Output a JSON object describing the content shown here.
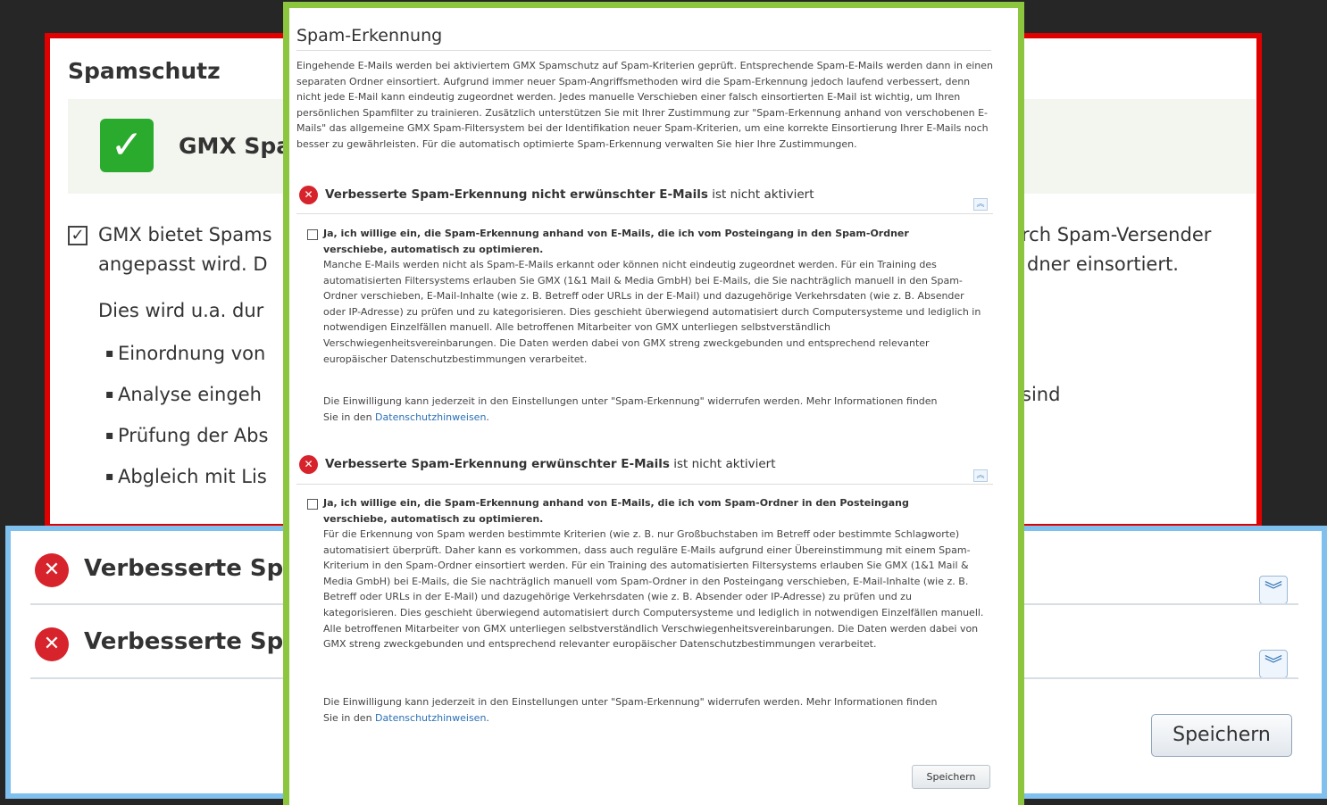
{
  "background": {
    "spamschutz": {
      "title": "Spamschutz",
      "status_text": "GMX Spa",
      "desc_line1_left": "GMX bietet Spams",
      "desc_line1_right": "rch Spam-Versender",
      "desc_line2_left": "angepasst wird. D",
      "desc_line2_right": "dner einsortiert.",
      "intro_line": "Dies wird u.a. dur",
      "bullets": [
        "Einordnung von",
        "Analyse eingeh",
        "Prüfung der Abs",
        "Abgleich mit Lis"
      ],
      "bullet2_right": "sind"
    },
    "rows": [
      {
        "title": "Verbesserte Spa",
        "expand_icon": "double-chevron-down"
      },
      {
        "title": "Verbesserte Spa",
        "expand_icon": "double-chevron-down"
      }
    ],
    "save_label": "Speichern"
  },
  "modal": {
    "title": "Spam-Erkennung",
    "intro": "Eingehende E-Mails werden bei aktiviertem GMX Spamschutz auf Spam-Kriterien geprüft. Entsprechende Spam-E-Mails werden dann in einen separaten Ordner einsortiert. Aufgrund immer neuer Spam-Angriffsmethoden wird die Spam-Erkennung jedoch laufend verbessert, denn nicht jede E-Mail kann eindeutig zugeordnet werden. Jedes manuelle Verschieben einer falsch einsortierten E-Mail ist wichtig, um Ihren persönlichen Spamfilter zu trainieren. Zusätzlich unterstützen Sie mit Ihrer Zustimmung zur \"Spam-Erkennung anhand von verschobenen E-Mails\" das allgemeine GMX Spam-Filtersystem bei der Identifikation neuer Spam-Kriterien, um eine korrekte Einsortierung Ihrer E-Mails noch besser zu gewährleisten. Für die automatisch optimierte Spam-Erkennung verwalten Sie hier Ihre Zustimmungen.",
    "sections": [
      {
        "title_bold": "Verbesserte Spam-Erkennung nicht erwünschter E-Mails",
        "title_status": " ist nicht aktiviert",
        "checkbox_label": "Ja, ich willige ein, die Spam-Erkennung anhand von E-Mails, die ich vom Posteingang in den Spam-Ordner verschiebe, automatisch zu optimieren.",
        "description": "Manche E-Mails werden nicht als Spam-E-Mails erkannt oder können nicht eindeutig zugeordnet werden. Für ein Training des automatisierten Filtersystems erlauben Sie GMX (1&1 Mail & Media GmbH) bei E-Mails, die Sie nachträglich manuell in den Spam-Ordner verschieben, E-Mail-Inhalte (wie z. B. Betreff oder URLs in der E-Mail) und dazugehörige Verkehrsdaten (wie z. B. Absender oder IP-Adresse) zu prüfen und zu kategorisieren. Dies geschieht überwiegend automatisiert durch Computersysteme und lediglich in notwendigen Einzelfällen manuell. Alle betroffenen Mitarbeiter von GMX unterliegen selbstverständlich Verschwiegenheitsvereinbarungen. Die Daten werden dabei von GMX streng zweckgebunden und entsprechend relevanter europäischer Datenschutzbestimmungen verarbeitet.",
        "note": "Die Einwilligung kann jederzeit in den Einstellungen unter \"Spam-Erkennung\" widerrufen werden. Mehr Informationen finden Sie in den ",
        "link": "Datenschutzhinweisen",
        "note_end": "."
      },
      {
        "title_bold": "Verbesserte Spam-Erkennung erwünschter E-Mails",
        "title_status": " ist nicht aktiviert",
        "checkbox_label": "Ja, ich willige ein, die Spam-Erkennung anhand von E-Mails, die ich vom Spam-Ordner in den Posteingang verschiebe, automatisch zu optimieren.",
        "description": "Für die Erkennung von Spam werden bestimmte Kriterien (wie z. B. nur Großbuchstaben im Betreff oder bestimmte Schlagworte) automatisiert überprüft. Daher kann es vorkommen, dass auch reguläre E-Mails aufgrund einer Übereinstimmung mit einem Spam-Kriterium in den Spam-Ordner einsortiert werden. Für ein Training des automatisierten Filtersystems erlauben Sie GMX (1&1 Mail & Media GmbH) bei E-Mails, die Sie nachträglich manuell vom Spam-Ordner in den Posteingang verschieben, E-Mail-Inhalte (wie z. B. Betreff oder URLs in der E-Mail) und dazugehörige Verkehrsdaten (wie z. B. Absender oder IP-Adresse) zu prüfen und zu kategorisieren. Dies geschieht überwiegend automatisiert durch Computersysteme und lediglich in notwendigen Einzelfällen manuell. Alle betroffenen Mitarbeiter von GMX unterliegen selbstverständlich Verschwiegenheitsvereinbarungen. Die Daten werden dabei von GMX streng zweckgebunden und entsprechend relevanter europäischer Datenschutzbestimmungen verarbeitet.",
        "note": "Die Einwilligung kann jederzeit in den Einstellungen unter \"Spam-Erkennung\" widerrufen werden. Mehr Informationen finden Sie in den ",
        "link": "Datenschutzhinweisen",
        "note_end": "."
      }
    ],
    "save_label": "Speichern"
  },
  "colors": {
    "red_frame": "#e00000",
    "blue_frame": "#7fc0ee",
    "green_frame": "#8cc63f",
    "error_red": "#d7232b",
    "success_green": "#2bab2e",
    "link_blue": "#2a6fb5"
  },
  "icons": {
    "status_ok": "checkmark-icon",
    "status_error": "x-circle-icon",
    "expand": "double-chevron-down-icon",
    "collapse": "double-chevron-up-icon"
  }
}
